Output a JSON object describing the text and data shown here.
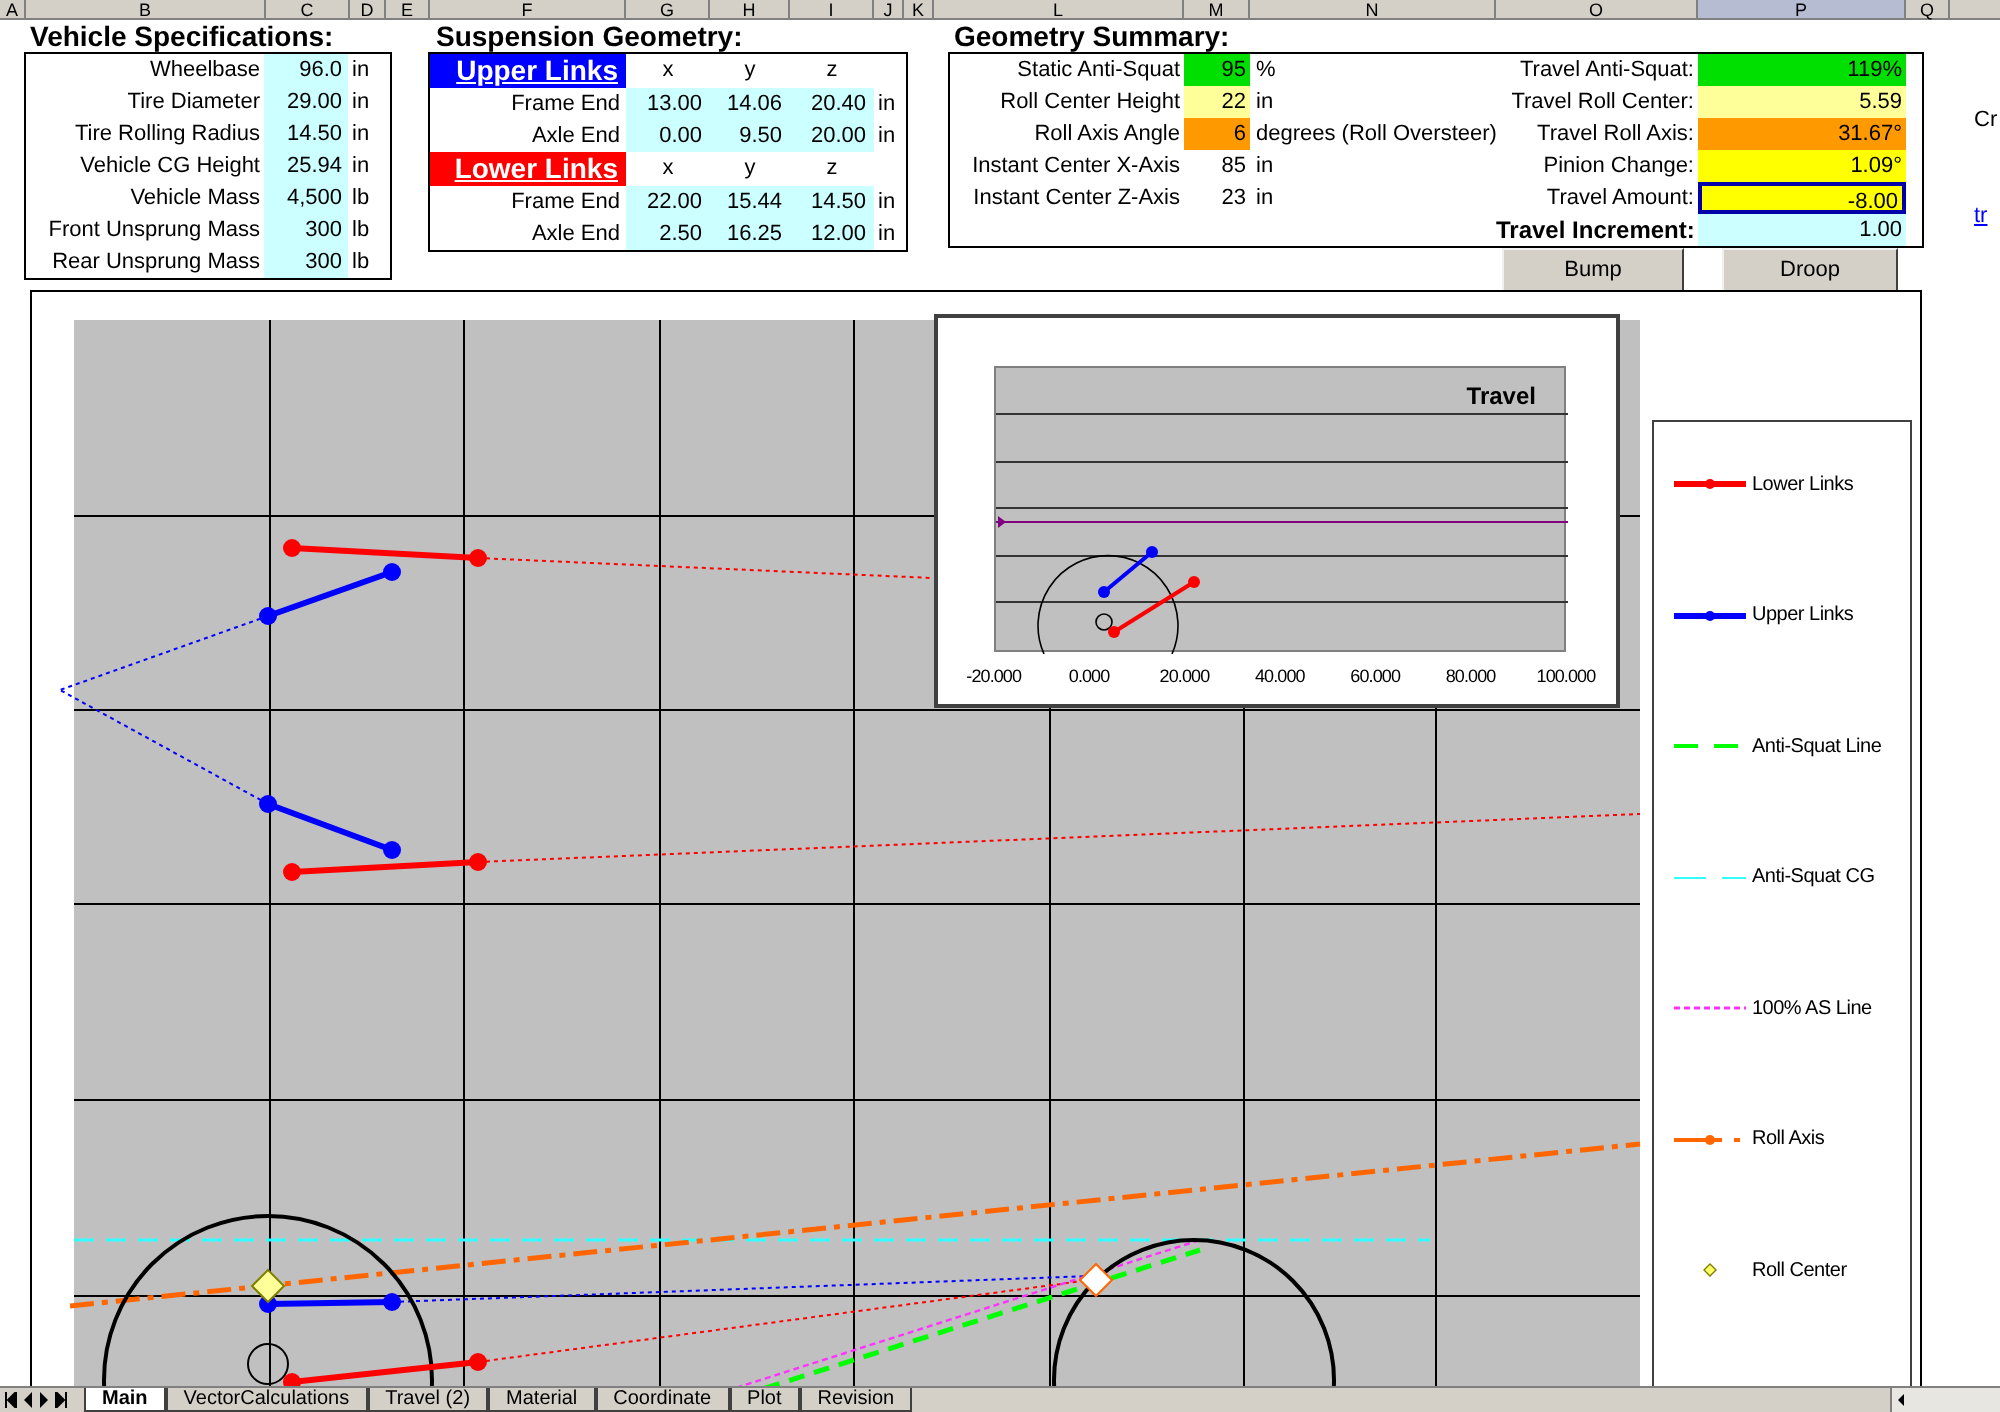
{
  "column_headers": [
    {
      "label": "A",
      "selected": false
    },
    {
      "label": "B",
      "selected": false
    },
    {
      "label": "C",
      "selected": false
    },
    {
      "label": "D",
      "selected": false
    },
    {
      "label": "E",
      "selected": false
    },
    {
      "label": "F",
      "selected": false
    },
    {
      "label": "G",
      "selected": false
    },
    {
      "label": "H",
      "selected": false
    },
    {
      "label": "I",
      "selected": false
    },
    {
      "label": "J",
      "selected": false
    },
    {
      "label": "K",
      "selected": false
    },
    {
      "label": "L",
      "selected": false
    },
    {
      "label": "M",
      "selected": false
    },
    {
      "label": "N",
      "selected": false
    },
    {
      "label": "O",
      "selected": false
    },
    {
      "label": "P",
      "selected": true
    },
    {
      "label": "Q",
      "selected": false
    }
  ],
  "vehicle_specs": {
    "title": "Vehicle Specifications:",
    "rows": [
      {
        "label": "Wheelbase",
        "value": "96.0",
        "unit": "in"
      },
      {
        "label": "Tire Diameter",
        "value": "29.00",
        "unit": "in"
      },
      {
        "label": "Tire Rolling Radius",
        "value": "14.50",
        "unit": "in"
      },
      {
        "label": "Vehicle CG Height",
        "value": "25.94",
        "unit": "in"
      },
      {
        "label": "Vehicle Mass",
        "value": "4,500",
        "unit": "lb"
      },
      {
        "label": "Front Unsprung Mass",
        "value": "300",
        "unit": "lb"
      },
      {
        "label": "Rear Unsprung Mass",
        "value": "300",
        "unit": "lb"
      }
    ]
  },
  "suspension": {
    "title": "Suspension Geometry:",
    "groups": [
      {
        "name": "Upper Links",
        "color": "#0000ff",
        "axes": [
          "x",
          "y",
          "z"
        ],
        "rows": [
          {
            "label": "Frame End",
            "values": [
              "13.00",
              "14.06",
              "20.40"
            ],
            "unit": "in"
          },
          {
            "label": "Axle End",
            "values": [
              "0.00",
              "9.50",
              "20.00"
            ],
            "unit": "in"
          }
        ]
      },
      {
        "name": "Lower Links",
        "color": "#ff0000",
        "axes": [
          "x",
          "y",
          "z"
        ],
        "rows": [
          {
            "label": "Frame End",
            "values": [
              "22.00",
              "15.44",
              "14.50"
            ],
            "unit": "in"
          },
          {
            "label": "Axle End",
            "values": [
              "2.50",
              "16.25",
              "12.00"
            ],
            "unit": "in"
          }
        ]
      }
    ]
  },
  "summary": {
    "title": "Geometry Summary:",
    "left": [
      {
        "label": "Static Anti-Squat",
        "value": "95",
        "unit": "%",
        "color": "#00e000"
      },
      {
        "label": "Roll Center Height",
        "value": "22",
        "unit": "in",
        "color": "#ffff99"
      },
      {
        "label": "Roll Axis Angle",
        "value": "6",
        "unit": "degrees (Roll Oversteer)",
        "color": "#ff9900"
      },
      {
        "label": "Instant Center X-Axis",
        "value": "85",
        "unit": "in",
        "color": "#ffffff"
      },
      {
        "label": "Instant Center Z-Axis",
        "value": "23",
        "unit": "in",
        "color": "#ffffff"
      }
    ],
    "right": [
      {
        "label": "Travel Anti-Squat:",
        "value": "119%",
        "color": "#00e000",
        "selected": false,
        "bold": false
      },
      {
        "label": "Travel Roll Center:",
        "value": "5.59",
        "color": "#ffff99",
        "selected": false,
        "bold": false
      },
      {
        "label": "Travel Roll Axis:",
        "value": "31.67°",
        "color": "#ff9900",
        "selected": false,
        "bold": false
      },
      {
        "label": "Pinion Change:",
        "value": "1.09°",
        "color": "#ffff00",
        "selected": false,
        "bold": false
      },
      {
        "label": "Travel Amount:",
        "value": "-8.00",
        "color": "#ffff00",
        "selected": true,
        "bold": false
      },
      {
        "label": "Travel Increment:",
        "value": "1.00",
        "color": "#ccffff",
        "selected": false,
        "bold": true
      }
    ]
  },
  "buttons": [
    "Bump",
    "Droop"
  ],
  "edge_texts": [
    {
      "text": "Cr",
      "kind": "plain"
    },
    {
      "text": "tr",
      "kind": "link"
    }
  ],
  "chart": {
    "inset": {
      "title": "Travel",
      "x_tick_labels": [
        "-20.000",
        "0.000",
        "20.000",
        "40.000",
        "60.000",
        "80.000",
        "100.000"
      ]
    },
    "legend": [
      {
        "label": "Lower Links",
        "color": "#ff0000",
        "kind": "line-marker"
      },
      {
        "label": "Upper Links",
        "color": "#0000ff",
        "kind": "line-marker"
      },
      {
        "label": "Anti-Squat Line",
        "color": "#00ff00",
        "kind": "dash"
      },
      {
        "label": "Anti-Squat CG",
        "color": "#33ffff",
        "kind": "long-dash"
      },
      {
        "label": "100% AS Line",
        "color": "#ff33ff",
        "kind": "dotted"
      },
      {
        "label": "Roll Axis",
        "color": "#ff6600",
        "kind": "dashdot-marker"
      },
      {
        "label": "Roll Center",
        "color": "#ffff66",
        "kind": "diamond"
      }
    ]
  },
  "sheet_tabs": [
    {
      "label": "Main",
      "selected": true
    },
    {
      "label": "VectorCalculations",
      "selected": false
    },
    {
      "label": "Travel (2)",
      "selected": false
    },
    {
      "label": "Material",
      "selected": false
    },
    {
      "label": "Coordinate",
      "selected": false
    },
    {
      "label": "Plot",
      "selected": false
    },
    {
      "label": "Revision",
      "selected": false
    }
  ]
}
